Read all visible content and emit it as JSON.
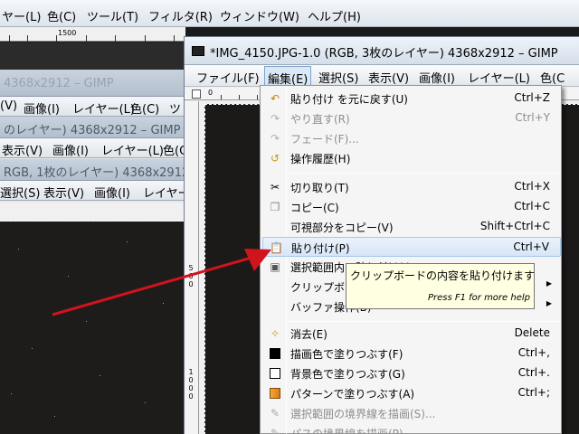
{
  "bg_window": {
    "menu": [
      "ヤー(L)",
      "色(C)",
      "ツール(T)",
      "フィルタ(R)",
      "ウィンドウ(W)",
      "ヘルプ(H)"
    ],
    "ruler_label": "1500",
    "stacked": [
      {
        "title": "",
        "menu": []
      },
      {
        "title": "のレイヤー) 4368x2912 – GIMP",
        "menu": [
          "(V)",
          "画像(I)",
          "レイヤー(L)",
          "色(C)",
          "ツ"
        ]
      },
      {
        "title": "",
        "menu": [
          "表示(V)",
          "画像(I)",
          "レイヤー(L)",
          "色(C)"
        ]
      },
      {
        "title": "RGB, 1枚のレイヤー) 4368x2912 – GIMP",
        "menu": [
          "選択(S)",
          "表示(V)",
          "画像(I)",
          "レイヤー"
        ]
      }
    ],
    "top_title": "4368x2912 – GIMP"
  },
  "window": {
    "title": "*IMG_4150.JPG-1.0 (RGB, 3枚のレイヤー) 4368x2912 – GIMP",
    "menu": [
      "ファイル(F)",
      "編集(E)",
      "選択(S)",
      "表示(V)",
      "画像(I)",
      "レイヤー(L)",
      "色(C"
    ],
    "active_menu": "編集(E)",
    "ruler_label": "0",
    "vruler_labels": [
      "500",
      "1000"
    ]
  },
  "edit_menu": {
    "items": [
      {
        "label": "貼り付け を元に戻す(U)",
        "shortcut": "Ctrl+Z",
        "icon": "undo-icon",
        "disabled": false
      },
      {
        "label": "やり直す(R)",
        "shortcut": "Ctrl+Y",
        "icon": "redo-icon",
        "disabled": true
      },
      {
        "label": "フェード(F)...",
        "shortcut": "",
        "icon": "fade-icon",
        "disabled": true
      },
      {
        "label": "操作履歴(H)",
        "shortcut": "",
        "icon": "history-icon",
        "disabled": false
      },
      {
        "separator": true
      },
      {
        "label": "切り取り(T)",
        "shortcut": "Ctrl+X",
        "icon": "scissors-icon",
        "disabled": false
      },
      {
        "label": "コピー(C)",
        "shortcut": "Ctrl+C",
        "icon": "copy-icon",
        "disabled": false
      },
      {
        "label": "可視部分をコピー(V)",
        "shortcut": "Shift+Ctrl+C",
        "icon": "",
        "disabled": false
      },
      {
        "label": "貼り付け(P)",
        "shortcut": "Ctrl+V",
        "icon": "paste-icon",
        "disabled": false,
        "highlighted": true
      },
      {
        "label": "選択範囲内へ貼り付け(I)",
        "shortcut": "",
        "icon": "paste-into-icon",
        "disabled": false
      },
      {
        "label": "クリップボ",
        "shortcut": "",
        "icon": "",
        "disabled": false,
        "submenu": true
      },
      {
        "label": "バッファ操作(B)",
        "shortcut": "",
        "icon": "",
        "disabled": false,
        "submenu": true
      },
      {
        "separator": true
      },
      {
        "label": "消去(E)",
        "shortcut": "Delete",
        "icon": "clear-icon",
        "disabled": false
      },
      {
        "label": "描画色で塗りつぶす(F)",
        "shortcut": "Ctrl+,",
        "icon": "fg-fill-icon",
        "disabled": false
      },
      {
        "label": "背景色で塗りつぶす(G)",
        "shortcut": "Ctrl+.",
        "icon": "bg-fill-icon",
        "disabled": false
      },
      {
        "label": "パターンで塗りつぶす(A)",
        "shortcut": "Ctrl+;",
        "icon": "pattern-fill-icon",
        "disabled": false
      },
      {
        "label": "選択範囲の境界線を描画(S)...",
        "shortcut": "",
        "icon": "stroke-selection-icon",
        "disabled": true
      },
      {
        "label": "パスの境界線を描画(P)...",
        "shortcut": "",
        "icon": "stroke-path-icon",
        "disabled": true
      }
    ]
  },
  "tooltip": {
    "text": "クリップボードの内容を貼り付けます",
    "help": "Press F1 for more help"
  },
  "colors": {
    "annotation_arrow": "#d0141e",
    "highlight": "#d7e6f7"
  }
}
